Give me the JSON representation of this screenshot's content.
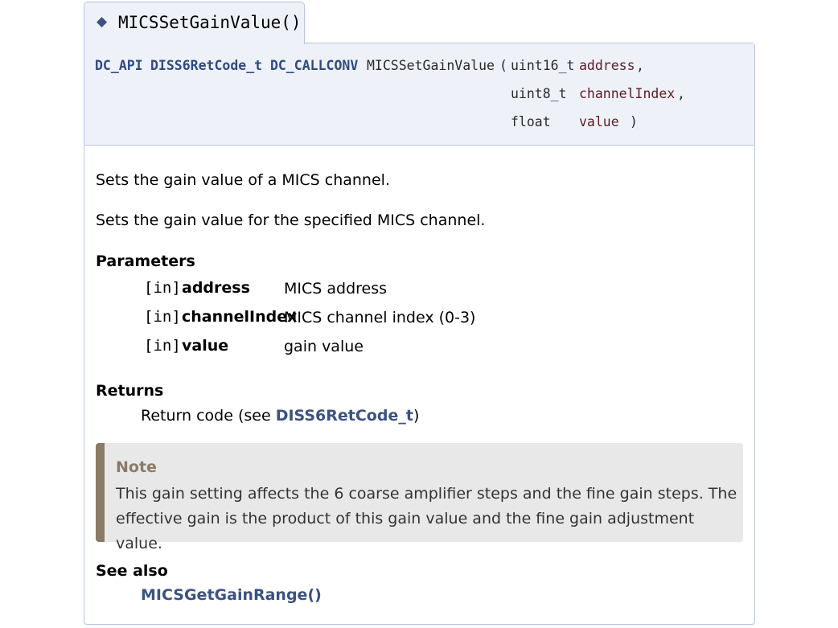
{
  "header": {
    "diamond": "◆",
    "title": "MICSSetGainValue()"
  },
  "prototype": {
    "kw1": "DC_API",
    "return_type": "DISS6RetCode_t",
    "kw2": "DC_CALLCONV",
    "func_name": "MICSSetGainValue",
    "open_paren": "(",
    "params": [
      {
        "type": "uint16_t",
        "name": "address",
        "sep": ","
      },
      {
        "type": "uint8_t",
        "name": "channelIndex",
        "sep": ","
      },
      {
        "type": "float",
        "name": "value",
        "sep": ")"
      }
    ]
  },
  "brief": "Sets the gain value of a MICS channel.",
  "details": "Sets the gain value for the specified MICS channel.",
  "parameters": {
    "heading": "Parameters",
    "items": [
      {
        "dir": "[in]",
        "name": "address",
        "desc": "MICS address"
      },
      {
        "dir": "[in]",
        "name": "channelIndex",
        "desc": "MICS channel index (0-3)"
      },
      {
        "dir": "[in]",
        "name": "value",
        "desc": "gain value"
      }
    ]
  },
  "returns": {
    "heading": "Returns",
    "prefix": "Return code (see ",
    "link": "DISS6RetCode_t",
    "suffix": ")"
  },
  "note": {
    "title": "Note",
    "body": "This gain setting affects the 6 coarse amplifier steps and the fine gain steps. The effective gain is the product of this gain value and the fine gain adjustment value."
  },
  "see_also": {
    "heading": "See also",
    "link": "MICSGetGainRange()"
  },
  "colors": {
    "accent": "#3b5283",
    "note_bar": "#8a7b66",
    "proto_bg": "#eef1f8",
    "param_name": "#5b1e22"
  }
}
